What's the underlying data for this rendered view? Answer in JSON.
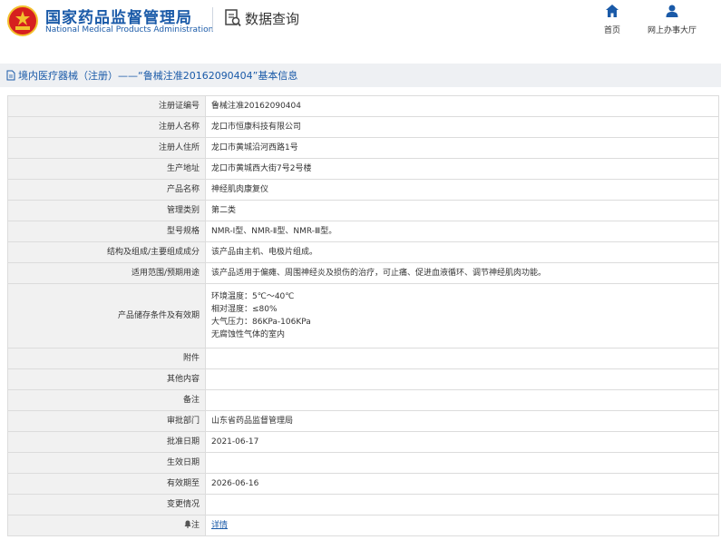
{
  "header": {
    "org_cn": "国家药品监督管理局",
    "org_en": "National Medical Products Administration",
    "query_label": "数据查询",
    "nav": [
      {
        "label": "首页",
        "icon": "home-icon"
      },
      {
        "label": "网上办事大厅",
        "icon": "user-icon"
      }
    ]
  },
  "breadcrumb": "境内医疗器械（注册）——“鲁械注准20162090404”基本信息",
  "rows": [
    {
      "key": "注册证编号",
      "value": "鲁械注准20162090404"
    },
    {
      "key": "注册人名称",
      "value": "龙口市恒康科技有限公司"
    },
    {
      "key": "注册人住所",
      "value": "龙口市黄城沿河西路1号"
    },
    {
      "key": "生产地址",
      "value": "龙口市黄城西大街7号2号楼"
    },
    {
      "key": "产品名称",
      "value": "神经肌肉康复仪"
    },
    {
      "key": "管理类别",
      "value": "第二类"
    },
    {
      "key": "型号规格",
      "value": "NMR-Ⅰ型、NMR-Ⅱ型、NMR-Ⅲ型。"
    },
    {
      "key": "结构及组成/主要组成成分",
      "value": "该产品由主机、电极片组成。"
    },
    {
      "key": "适用范围/预期用途",
      "value": "该产品适用于偏瘫、周围神经炎及损伤的治疗，可止痛、促进血液循环、调节神经肌肉功能。"
    }
  ],
  "storage": {
    "key": "产品储存条件及有效期",
    "lines": [
      "环境温度：5℃～40℃",
      "相对湿度：≤80%",
      "大气压力：86KPa-106KPa",
      "无腐蚀性气体的室内"
    ]
  },
  "rows2": [
    {
      "key": "附件",
      "value": ""
    },
    {
      "key": "其他内容",
      "value": ""
    },
    {
      "key": "备注",
      "value": ""
    },
    {
      "key": "审批部门",
      "value": "山东省药品监督管理局"
    },
    {
      "key": "批准日期",
      "value": "2021-06-17"
    },
    {
      "key": "生效日期",
      "value": ""
    },
    {
      "key": "有效期至",
      "value": "2026-06-16"
    },
    {
      "key": "变更情况",
      "value": ""
    }
  ],
  "note": {
    "key": "注",
    "icon": "bell-icon",
    "link": "详情"
  },
  "colors": {
    "brand_blue": "#1a5aa8",
    "emblem_red": "#d61f1f",
    "emblem_gold": "#f2c12e"
  }
}
